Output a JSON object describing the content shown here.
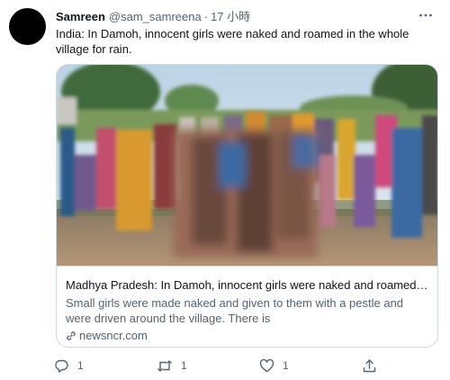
{
  "author": {
    "display_name": "Samreen",
    "handle": "@sam_samreena",
    "separator": "·",
    "time": "17 小時"
  },
  "tweet": {
    "text": "India: In Damoh, innocent girls were naked and roamed in the whole village for rain."
  },
  "card": {
    "title": "Madhya Pradesh: In Damoh, innocent girls were naked and roamed in ...",
    "description": "Small girls were made naked and given to them with a pestle and were driven around the village. There is",
    "domain": "newsncr.com",
    "image_blurred": true
  },
  "actions": {
    "reply_count": "1",
    "retweet_count": "1",
    "like_count": "1"
  },
  "colors": {
    "text_primary": "#0f1419",
    "text_secondary": "#536471",
    "border": "#cfd9de"
  },
  "icons": [
    "more-icon",
    "link-icon",
    "reply-icon",
    "retweet-icon",
    "like-icon",
    "share-icon"
  ]
}
